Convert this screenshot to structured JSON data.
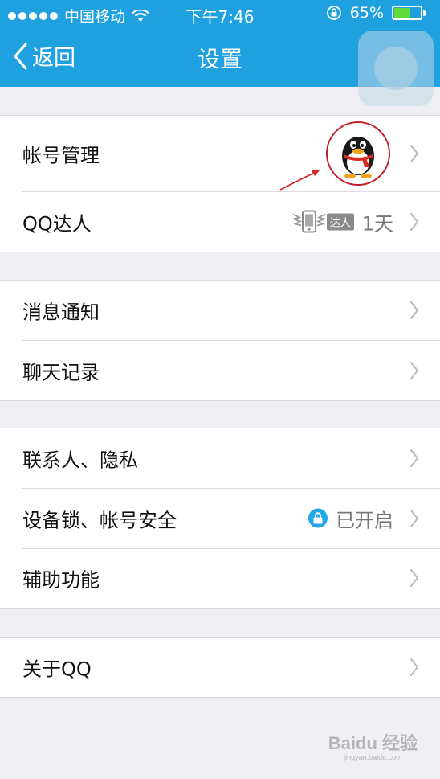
{
  "status_bar": {
    "carrier": "中国移动",
    "time": "下午7:46",
    "battery_percent": "65%",
    "battery_level": 0.65,
    "signal_dots_filled": 5
  },
  "nav": {
    "back_label": "返回",
    "title": "设置"
  },
  "groups": [
    {
      "rows": [
        {
          "label": "帐号管理",
          "right_type": "avatar"
        },
        {
          "label": "QQ达人",
          "badge_text": "达人",
          "right_value": "1天"
        }
      ]
    },
    {
      "rows": [
        {
          "label": "消息通知"
        },
        {
          "label": "聊天记录"
        }
      ]
    },
    {
      "rows": [
        {
          "label": "联系人、隐私"
        },
        {
          "label": "设备锁、帐号安全",
          "right_value": "已开启",
          "right_icon": "lock-icon"
        },
        {
          "label": "辅助功能"
        }
      ]
    },
    {
      "rows": [
        {
          "label": "关于QQ"
        }
      ]
    }
  ],
  "watermark": {
    "text": "Baidu 经验",
    "subtext": "jingyan.baidu.com"
  },
  "colors": {
    "header_bg": "#1fa1e0",
    "page_bg": "#efeff4",
    "annotation_red": "#c0202c",
    "lock_blue": "#23a7e8",
    "battery_green": "#5fdc3a"
  }
}
